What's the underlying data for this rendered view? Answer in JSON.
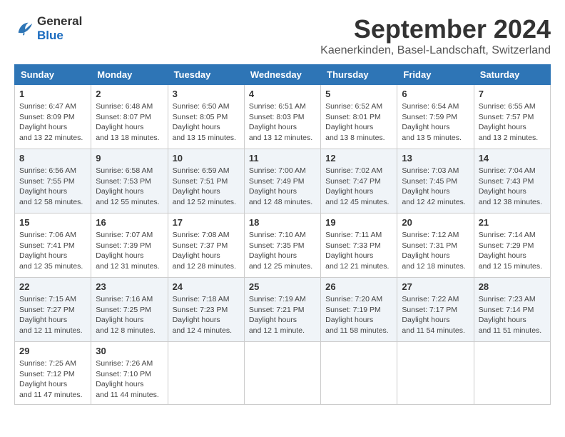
{
  "header": {
    "logo_general": "General",
    "logo_blue": "Blue",
    "month": "September 2024",
    "location": "Kaenerkinden, Basel-Landschaft, Switzerland"
  },
  "weekdays": [
    "Sunday",
    "Monday",
    "Tuesday",
    "Wednesday",
    "Thursday",
    "Friday",
    "Saturday"
  ],
  "weeks": [
    [
      {
        "day": 1,
        "sunrise": "6:47 AM",
        "sunset": "8:09 PM",
        "daylight": "13 hours and 22 minutes."
      },
      {
        "day": 2,
        "sunrise": "6:48 AM",
        "sunset": "8:07 PM",
        "daylight": "13 hours and 18 minutes."
      },
      {
        "day": 3,
        "sunrise": "6:50 AM",
        "sunset": "8:05 PM",
        "daylight": "13 hours and 15 minutes."
      },
      {
        "day": 4,
        "sunrise": "6:51 AM",
        "sunset": "8:03 PM",
        "daylight": "13 hours and 12 minutes."
      },
      {
        "day": 5,
        "sunrise": "6:52 AM",
        "sunset": "8:01 PM",
        "daylight": "13 hours and 8 minutes."
      },
      {
        "day": 6,
        "sunrise": "6:54 AM",
        "sunset": "7:59 PM",
        "daylight": "13 hours and 5 minutes."
      },
      {
        "day": 7,
        "sunrise": "6:55 AM",
        "sunset": "7:57 PM",
        "daylight": "13 hours and 2 minutes."
      }
    ],
    [
      {
        "day": 8,
        "sunrise": "6:56 AM",
        "sunset": "7:55 PM",
        "daylight": "12 hours and 58 minutes."
      },
      {
        "day": 9,
        "sunrise": "6:58 AM",
        "sunset": "7:53 PM",
        "daylight": "12 hours and 55 minutes."
      },
      {
        "day": 10,
        "sunrise": "6:59 AM",
        "sunset": "7:51 PM",
        "daylight": "12 hours and 52 minutes."
      },
      {
        "day": 11,
        "sunrise": "7:00 AM",
        "sunset": "7:49 PM",
        "daylight": "12 hours and 48 minutes."
      },
      {
        "day": 12,
        "sunrise": "7:02 AM",
        "sunset": "7:47 PM",
        "daylight": "12 hours and 45 minutes."
      },
      {
        "day": 13,
        "sunrise": "7:03 AM",
        "sunset": "7:45 PM",
        "daylight": "12 hours and 42 minutes."
      },
      {
        "day": 14,
        "sunrise": "7:04 AM",
        "sunset": "7:43 PM",
        "daylight": "12 hours and 38 minutes."
      }
    ],
    [
      {
        "day": 15,
        "sunrise": "7:06 AM",
        "sunset": "7:41 PM",
        "daylight": "12 hours and 35 minutes."
      },
      {
        "day": 16,
        "sunrise": "7:07 AM",
        "sunset": "7:39 PM",
        "daylight": "12 hours and 31 minutes."
      },
      {
        "day": 17,
        "sunrise": "7:08 AM",
        "sunset": "7:37 PM",
        "daylight": "12 hours and 28 minutes."
      },
      {
        "day": 18,
        "sunrise": "7:10 AM",
        "sunset": "7:35 PM",
        "daylight": "12 hours and 25 minutes."
      },
      {
        "day": 19,
        "sunrise": "7:11 AM",
        "sunset": "7:33 PM",
        "daylight": "12 hours and 21 minutes."
      },
      {
        "day": 20,
        "sunrise": "7:12 AM",
        "sunset": "7:31 PM",
        "daylight": "12 hours and 18 minutes."
      },
      {
        "day": 21,
        "sunrise": "7:14 AM",
        "sunset": "7:29 PM",
        "daylight": "12 hours and 15 minutes."
      }
    ],
    [
      {
        "day": 22,
        "sunrise": "7:15 AM",
        "sunset": "7:27 PM",
        "daylight": "12 hours and 11 minutes."
      },
      {
        "day": 23,
        "sunrise": "7:16 AM",
        "sunset": "7:25 PM",
        "daylight": "12 hours and 8 minutes."
      },
      {
        "day": 24,
        "sunrise": "7:18 AM",
        "sunset": "7:23 PM",
        "daylight": "12 hours and 4 minutes."
      },
      {
        "day": 25,
        "sunrise": "7:19 AM",
        "sunset": "7:21 PM",
        "daylight": "12 hours and 1 minute."
      },
      {
        "day": 26,
        "sunrise": "7:20 AM",
        "sunset": "7:19 PM",
        "daylight": "11 hours and 58 minutes."
      },
      {
        "day": 27,
        "sunrise": "7:22 AM",
        "sunset": "7:17 PM",
        "daylight": "11 hours and 54 minutes."
      },
      {
        "day": 28,
        "sunrise": "7:23 AM",
        "sunset": "7:14 PM",
        "daylight": "11 hours and 51 minutes."
      }
    ],
    [
      {
        "day": 29,
        "sunrise": "7:25 AM",
        "sunset": "7:12 PM",
        "daylight": "11 hours and 47 minutes."
      },
      {
        "day": 30,
        "sunrise": "7:26 AM",
        "sunset": "7:10 PM",
        "daylight": "11 hours and 44 minutes."
      },
      null,
      null,
      null,
      null,
      null
    ]
  ]
}
